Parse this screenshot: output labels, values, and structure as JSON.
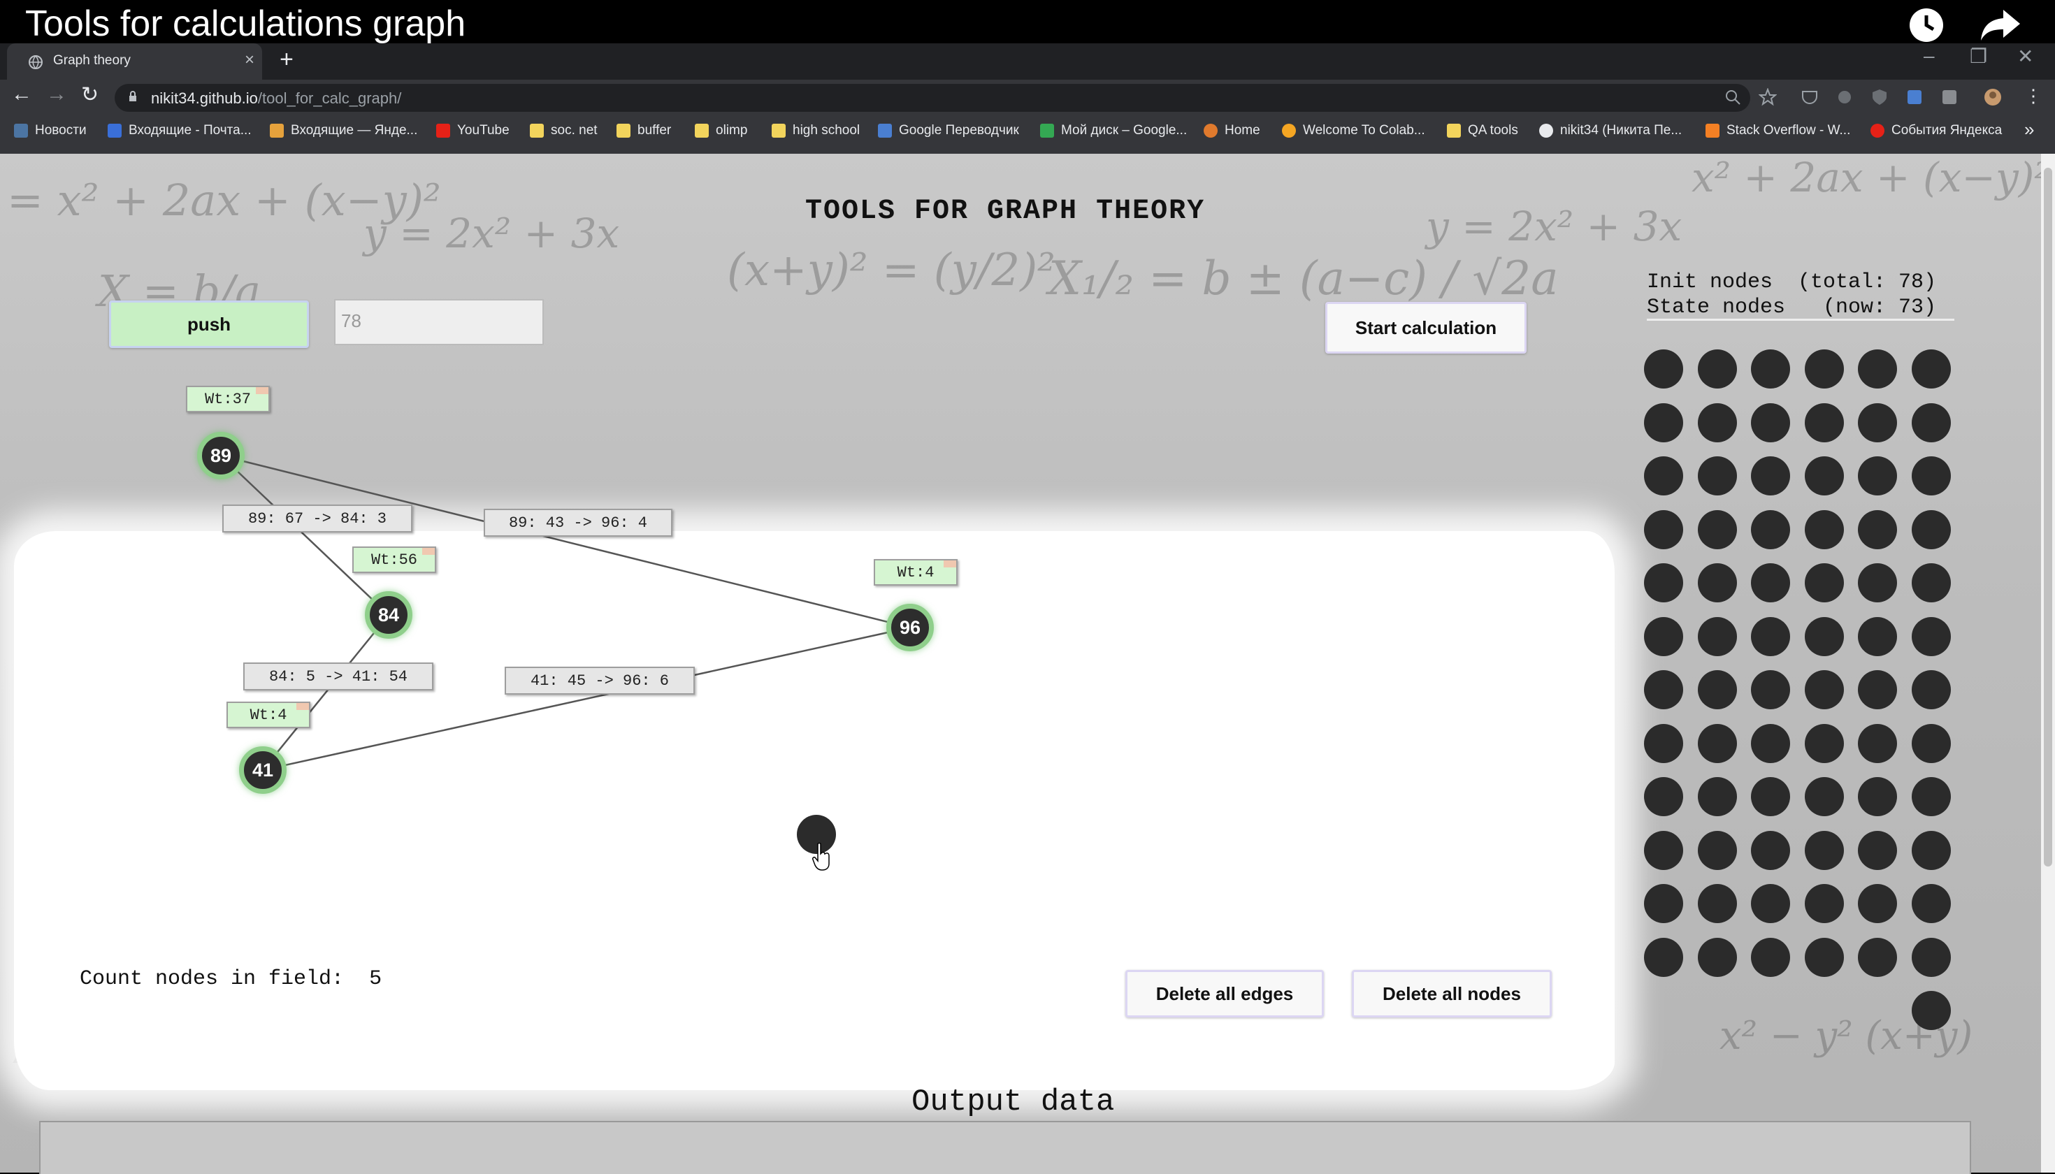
{
  "video": {
    "title": "Tools for calculations graph"
  },
  "browser": {
    "tab_title": "Graph theory",
    "url_host": "nikit34.github.io",
    "url_path": "/tool_for_calc_graph/",
    "bookmarks": [
      "Новости",
      "Входящие - Почта...",
      "Входящие — Янде...",
      "YouTube",
      "soc. net",
      "buffer",
      "olimp",
      "high school",
      "Google Переводчик",
      "Мой диск – Google...",
      "Home",
      "Welcome To Colab...",
      "QA tools",
      "nikit34 (Никита Пе...",
      "Stack Overflow - W...",
      "События Яндекса"
    ]
  },
  "page": {
    "title": "TOOLS FOR GRAPH THEORY",
    "push_label": "push",
    "push_input_value": "78",
    "start_label": "Start calculation",
    "init_nodes_text": "Init nodes  (total: 78)",
    "state_nodes_text": "State nodes   (now: 73)",
    "count_label": "Count nodes in field:",
    "count_value": "5",
    "delete_edges_label": "Delete all edges",
    "delete_nodes_label": "Delete all nodes",
    "output_title": "Output data"
  },
  "graph": {
    "nodes": [
      {
        "id": "89",
        "weight": "Wt:37"
      },
      {
        "id": "84",
        "weight": "Wt:56"
      },
      {
        "id": "96",
        "weight": "Wt:4"
      },
      {
        "id": "41",
        "weight": "Wt:4"
      }
    ],
    "edge_labels": [
      "89: 67 -> 84: 3",
      "89: 43 -> 96: 4",
      "84: 5 -> 41: 54",
      "41: 45 -> 96: 6"
    ]
  },
  "stock_nodes": {
    "count": 73
  },
  "colors": {
    "node_fill": "#2d2d2d",
    "node_ring": "#8fcf8b",
    "weight_bg": "#d6f5d2",
    "push_bg": "#c8f0c4"
  }
}
